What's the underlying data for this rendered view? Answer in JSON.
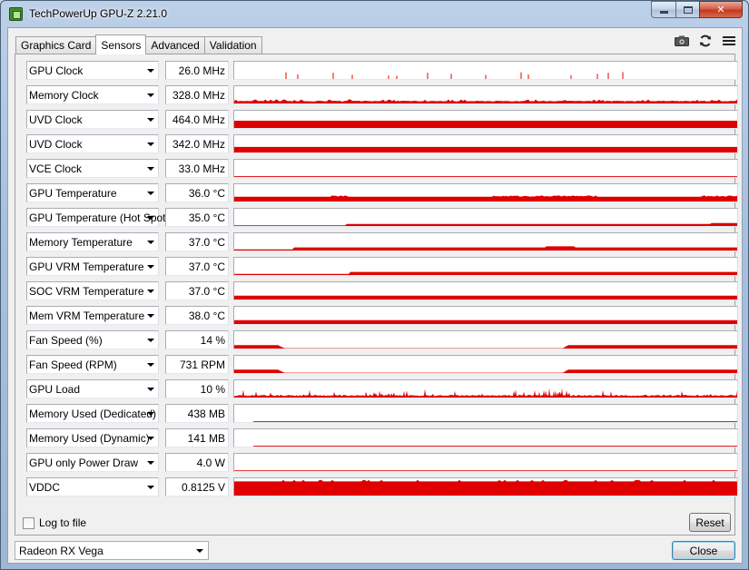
{
  "window": {
    "title": "TechPowerUp GPU-Z 2.21.0",
    "caption_close_glyph": "✕"
  },
  "tabs": [
    {
      "label": "Graphics Card",
      "active": false
    },
    {
      "label": "Sensors",
      "active": true
    },
    {
      "label": "Advanced",
      "active": false
    },
    {
      "label": "Validation",
      "active": false
    }
  ],
  "toolbar": {
    "icons": [
      "camera-icon",
      "refresh-icon",
      "menu-icon"
    ]
  },
  "colors": {
    "graph_fill": "#e00000"
  },
  "sensors": [
    {
      "label": "GPU Clock",
      "value": "26.0 MHz",
      "pattern": "spikes"
    },
    {
      "label": "Memory Clock",
      "value": "328.0 MHz",
      "pattern": "noisy_low",
      "level": 0.12
    },
    {
      "label": "UVD Clock",
      "value": "464.0 MHz",
      "pattern": "flat",
      "level": 0.42
    },
    {
      "label": "UVD Clock",
      "value": "342.0 MHz",
      "pattern": "flat",
      "level": 0.32
    },
    {
      "label": "VCE Clock",
      "value": "33.0 MHz",
      "pattern": "flat",
      "level": 0.05
    },
    {
      "label": "GPU Temperature",
      "value": "36.0 °C",
      "pattern": "flat_bumps",
      "level": 0.28
    },
    {
      "label": "GPU Temperature (Hot Spot)",
      "value": "35.0 °C",
      "pattern": "step",
      "level": 0.12
    },
    {
      "label": "Memory Temperature",
      "value": "37.0 °C",
      "pattern": "step",
      "level": 0.18
    },
    {
      "label": "GPU VRM Temperature",
      "value": "37.0 °C",
      "pattern": "step",
      "level": 0.18
    },
    {
      "label": "SOC VRM Temperature",
      "value": "37.0 °C",
      "pattern": "flat",
      "level": 0.22
    },
    {
      "label": "Mem VRM Temperature",
      "value": "38.0 °C",
      "pattern": "flat",
      "level": 0.22
    },
    {
      "label": "Fan Speed (%)",
      "value": "14 %",
      "pattern": "fan"
    },
    {
      "label": "Fan Speed (RPM)",
      "value": "731 RPM",
      "pattern": "fan"
    },
    {
      "label": "GPU Load",
      "value": "10 %",
      "pattern": "load"
    },
    {
      "label": "Memory Used (Dedicated)",
      "value": "438 MB",
      "pattern": "flat_late",
      "level": 0.05
    },
    {
      "label": "Memory Used (Dynamic)",
      "value": "141 MB",
      "pattern": "flat_late",
      "level": 0.05
    },
    {
      "label": "GPU only Power Draw",
      "value": "4.0 W",
      "pattern": "flat",
      "level": 0.04
    },
    {
      "label": "VDDC",
      "value": "0.8125 V",
      "pattern": "full",
      "level": 0.82
    }
  ],
  "footer": {
    "log_label": "Log to file",
    "log_checked": false,
    "reset_label": "Reset",
    "gpu_select": "Radeon RX Vega",
    "close_label": "Close"
  }
}
